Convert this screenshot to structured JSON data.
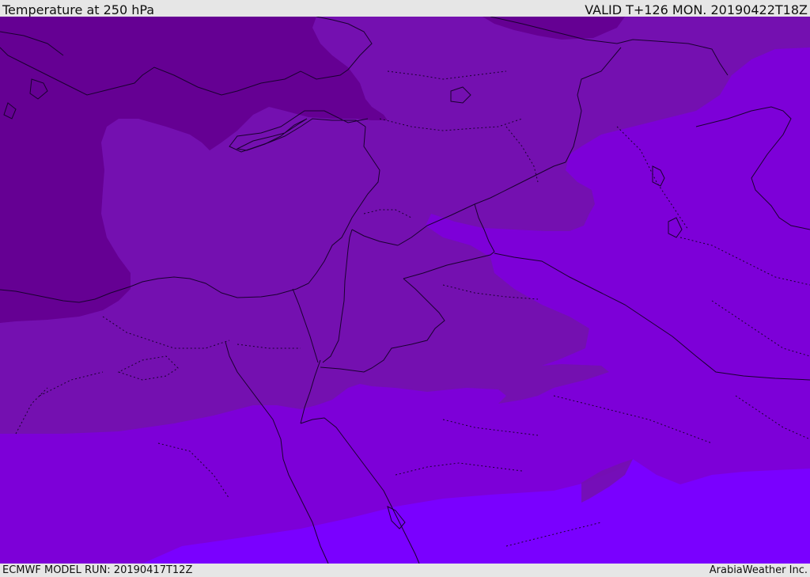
{
  "header": {
    "title": "Temperature at 250 hPa",
    "valid_time": "VALID T+126 MON. 20190422T18Z"
  },
  "footer": {
    "model_run": "ECMWF MODEL RUN: 20190417T12Z",
    "credit": "ArabiaWeather Inc."
  },
  "map": {
    "region": "Eastern Mediterranean and Middle East",
    "colors": {
      "coldest": "#650093",
      "cold": "#7410b0",
      "mid": "#7d00d8",
      "warmest": "#7a00ff",
      "border_line": "#1a0030"
    }
  }
}
